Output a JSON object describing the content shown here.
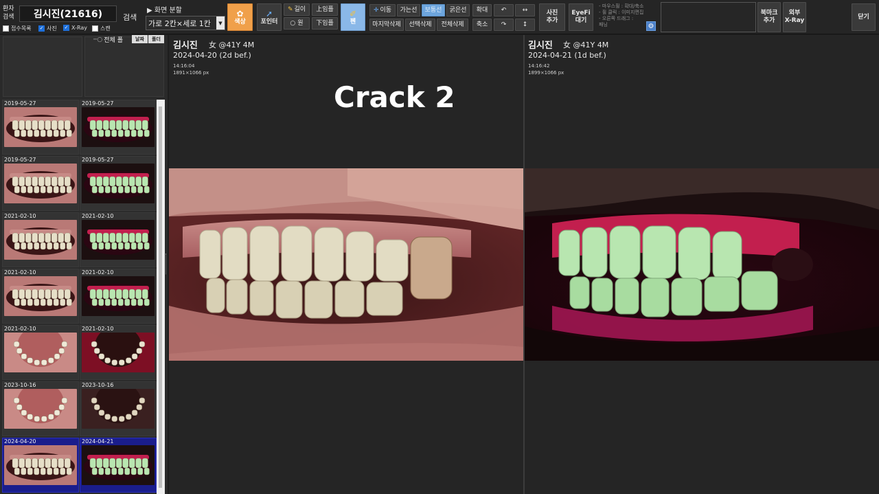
{
  "colors": {
    "background": "#1e1e1e",
    "toolbar": "#252525",
    "selected_thumb": "#1a1d8c",
    "color_btn": "#f0a04a",
    "pen_btn": "#8ab8e8",
    "line_active": "#6da5dd"
  },
  "toolbar": {
    "patient_search_label": "환자\n검색",
    "patient_name_display": "김시진(21616)",
    "search_label": "검색",
    "split_label": "▶ 화면 분할",
    "split_value": "가로 2칸×세로 1칸",
    "checkboxes": [
      {
        "label": "접수목록",
        "checked": false
      },
      {
        "label": "사진",
        "checked": true
      },
      {
        "label": "X-Ray",
        "checked": true
      },
      {
        "label": "스캔",
        "checked": false
      }
    ],
    "color_label": "색상",
    "pointer_label": "포인터",
    "length_label": "길이",
    "circle_label": "원",
    "upper_teeth_label": "上임플",
    "lower_teeth_label": "下임플",
    "pen_label": "펜",
    "move_label": "이동",
    "thin_line_label": "가는선",
    "normal_line_label": "보통선",
    "thick_line_label": "굵은선",
    "delete_last_label": "마지막삭제",
    "delete_selected_label": "선택삭제",
    "delete_all_label": "전체삭제",
    "zoom_in_label": "확대",
    "zoom_out_label": "축소",
    "rotate_left_label": "↶",
    "rotate_right_label": "↷",
    "flip_h_label": "↔",
    "flip_v_label": "↕",
    "add_photo_label": "사진\n추가",
    "eyefi_label": "EyeFi\n대기",
    "help_lines": [
      "- 마우스휠 : 확대/축소",
      "- 휠 클릭 : 이미지편집",
      "- 오른쪽 드래그 :",
      "패닝"
    ],
    "bookmark_label": "북마크\n추가",
    "external_xray_label": "외부\nX-Ray",
    "close_label": "닫기"
  },
  "sidebar": {
    "all_label": "전체 폴",
    "date_btn": "날짜",
    "folder_btn": "폴더",
    "thumbnails": [
      {
        "date": "2019-05-27",
        "kind": "normal"
      },
      {
        "date": "2019-05-27",
        "kind": "fluor"
      },
      {
        "date": "2019-05-27",
        "kind": "normal"
      },
      {
        "date": "2019-05-27",
        "kind": "fluor"
      },
      {
        "date": "2021-02-10",
        "kind": "normal"
      },
      {
        "date": "2021-02-10",
        "kind": "fluor"
      },
      {
        "date": "2021-02-10",
        "kind": "normal"
      },
      {
        "date": "2021-02-10",
        "kind": "fluor"
      },
      {
        "date": "2021-02-10",
        "kind": "arch"
      },
      {
        "date": "2021-02-10",
        "kind": "archred"
      },
      {
        "date": "2023-10-16",
        "kind": "arch"
      },
      {
        "date": "2023-10-16",
        "kind": "archdark"
      },
      {
        "date": "2024-04-20",
        "kind": "normal",
        "selected": true
      },
      {
        "date": "2024-04-21",
        "kind": "fluor",
        "selected": true
      }
    ]
  },
  "viewers": [
    {
      "name": "김시진",
      "sex_age": "女 @41Y 4M",
      "date": "2024-04-20 (2d bef.)",
      "time": "14:16:04",
      "size": "1891×1066 px",
      "overlay": "Crack 2"
    },
    {
      "name": "김시진",
      "sex_age": "女 @41Y 4M",
      "date": "2024-04-21 (1d bef.)",
      "time": "14:16:42",
      "size": "1899×1066 px"
    }
  ]
}
